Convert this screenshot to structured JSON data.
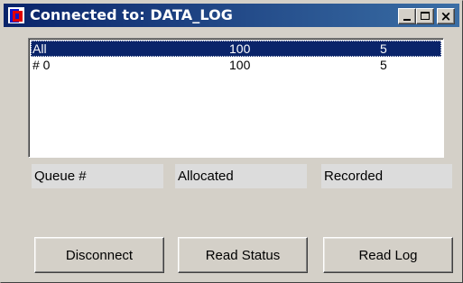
{
  "window": {
    "title": "Connected to: DATA_LOG",
    "controls": {
      "minimize": "minimize",
      "maximize": "maximize",
      "close": "×"
    }
  },
  "list": {
    "rows": [
      {
        "queue": "All",
        "allocated": "100",
        "recorded": "5",
        "selected": true
      },
      {
        "queue": "# 0",
        "allocated": "100",
        "recorded": "5",
        "selected": false
      }
    ]
  },
  "columns": {
    "queue": "Queue #",
    "allocated": "Allocated",
    "recorded": "Recorded"
  },
  "buttons": {
    "disconnect": "Disconnect",
    "read_status": "Read Status",
    "read_log": "Read Log"
  },
  "colors": {
    "titlebar_start": "#0a246a",
    "titlebar_end": "#3a6ea5",
    "selection": "#0a246a",
    "face": "#d4d0c8"
  },
  "icons": {
    "app": "app-icon",
    "minimize": "minimize-icon",
    "maximize": "maximize-icon",
    "close": "close-icon"
  }
}
